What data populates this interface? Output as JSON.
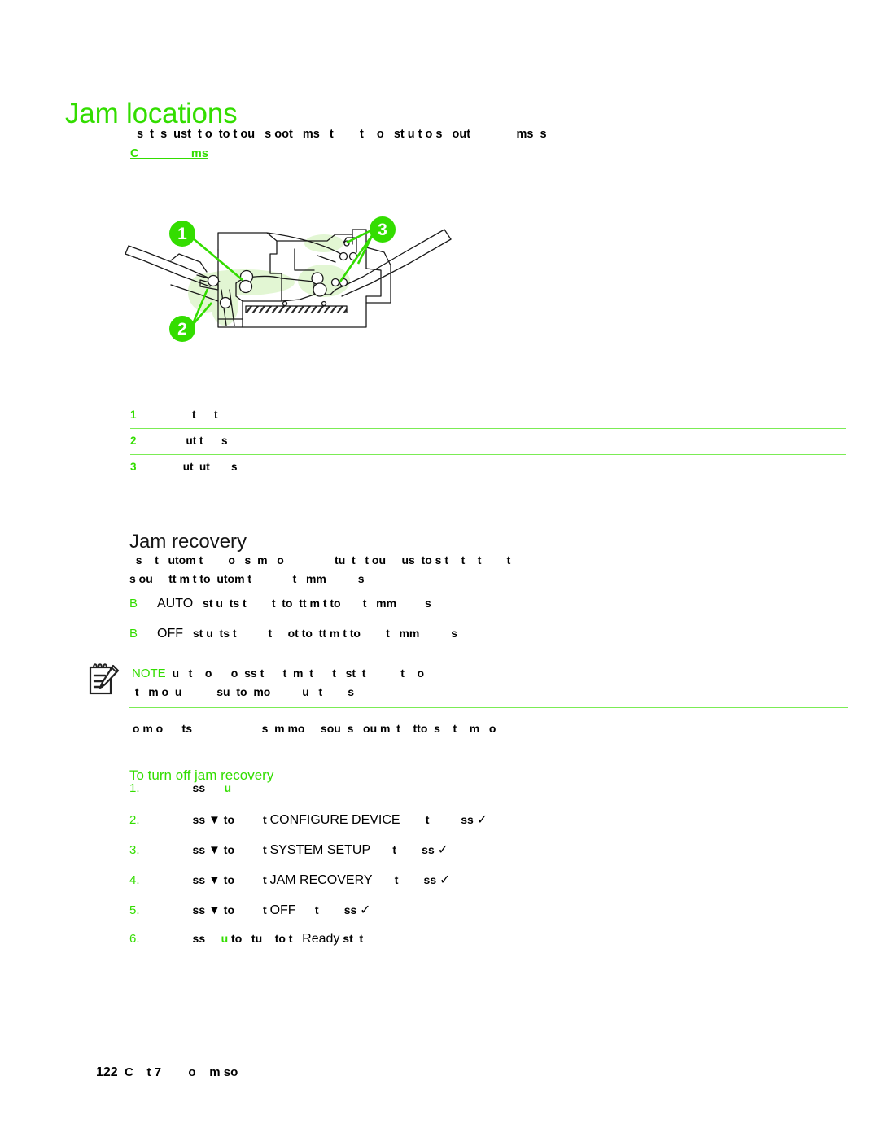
{
  "page": {
    "title": "Jam locations",
    "accent_green": "#33dd00",
    "rule_green": "#7bec55",
    "text_black": "#000000"
  },
  "intro": {
    "line1": "  s  t  s  ust  t o  to t ou   s oot   ms   t        t    o   st u t o s   out              ms  s",
    "link_text": "C                ms"
  },
  "diagram": {
    "name": "printer-cross-section-jam-locations",
    "callouts": [
      {
        "id": "1",
        "label": "1"
      },
      {
        "id": "2",
        "label": "2"
      },
      {
        "id": "3",
        "label": "3"
      }
    ]
  },
  "callout_table": {
    "rows": [
      {
        "num": "1",
        "desc": "    t      t"
      },
      {
        "num": "2",
        "desc": "  ut t      s"
      },
      {
        "num": "3",
        "desc": " ut  ut       s"
      }
    ]
  },
  "jam_recovery": {
    "heading": "Jam recovery",
    "paragraph": "  s    t   utom t        o   s  m   o                tu  t   t ou     us  to s t    t    t        t\ns ou     tt m t to  utom t             t   mm          s",
    "bullets": [
      {
        "mark": "B",
        "keyword": "AUTO",
        "text": " st u  ts t        t  to  tt m t to       t   mm         s"
      },
      {
        "mark": "B",
        "keyword": "OFF",
        "text": " st u  ts t          t     ot to  tt m t to        t   mm          s"
      }
    ],
    "note": {
      "icon": "note-pencil-icon",
      "label": "NOTE",
      "text": "  u   t    o      o  ss t      t  m  t      t   st  t           t    o\n t   m o  u           su  to  mo          u   t        s"
    },
    "after_note": " o m o      ts                      s  m mo     sou  s   ou m  t    tto  s    t    m   o"
  },
  "procedure": {
    "heading": "To turn off jam recovery",
    "steps": [
      {
        "num": "1.",
        "parts": [
          {
            "type": "plain",
            "text": "    ss      "
          },
          {
            "type": "green",
            "text": "u"
          }
        ]
      },
      {
        "num": "2.",
        "parts": [
          {
            "type": "plain",
            "text": "    ss "
          },
          {
            "type": "glyph",
            "text": "▼"
          },
          {
            "type": "plain",
            "text": " to        "
          },
          {
            "type": "plain",
            "text": " t "
          },
          {
            "type": "keyword",
            "text": "CONFIGURE DEVICE"
          },
          {
            "type": "plain",
            "text": "        t          ss "
          },
          {
            "type": "check",
            "text": "✓"
          }
        ]
      },
      {
        "num": "3.",
        "parts": [
          {
            "type": "plain",
            "text": "    ss "
          },
          {
            "type": "glyph",
            "text": "▼"
          },
          {
            "type": "plain",
            "text": " to        "
          },
          {
            "type": "plain",
            "text": " t "
          },
          {
            "type": "keyword",
            "text": "SYSTEM SETUP"
          },
          {
            "type": "plain",
            "text": "       t        ss "
          },
          {
            "type": "check",
            "text": "✓"
          }
        ]
      },
      {
        "num": "4.",
        "parts": [
          {
            "type": "plain",
            "text": "    ss "
          },
          {
            "type": "glyph",
            "text": "▼"
          },
          {
            "type": "plain",
            "text": " to        "
          },
          {
            "type": "plain",
            "text": " t "
          },
          {
            "type": "keyword",
            "text": "JAM RECOVERY"
          },
          {
            "type": "plain",
            "text": "       t        ss "
          },
          {
            "type": "check",
            "text": "✓"
          }
        ]
      },
      {
        "num": "5.",
        "parts": [
          {
            "type": "plain",
            "text": "    ss "
          },
          {
            "type": "glyph",
            "text": "▼"
          },
          {
            "type": "plain",
            "text": " to        "
          },
          {
            "type": "plain",
            "text": " t "
          },
          {
            "type": "keyword",
            "text": "OFF"
          },
          {
            "type": "plain",
            "text": "      t        ss "
          },
          {
            "type": "check",
            "text": "✓"
          }
        ]
      },
      {
        "num": "6.",
        "parts": [
          {
            "type": "plain",
            "text": "    ss     "
          },
          {
            "type": "green",
            "text": "u"
          },
          {
            "type": "plain",
            "text": " to   tu    to t   "
          },
          {
            "type": "keyword",
            "text": "Ready"
          },
          {
            "type": "plain",
            "text": " st  t"
          }
        ]
      }
    ]
  },
  "footer": {
    "page_number": "122",
    "text": "  C    t 7        o    m so"
  }
}
